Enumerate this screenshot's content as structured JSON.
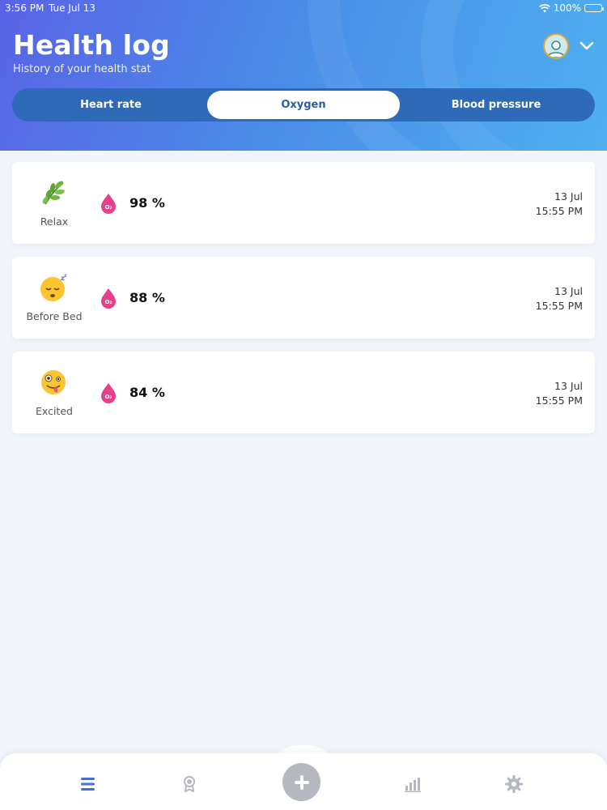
{
  "status_bar": {
    "time": "3:56 PM",
    "date": "Tue Jul 13",
    "battery": "100%",
    "icons": [
      "wifi-icon",
      "battery-icon"
    ]
  },
  "header": {
    "title": "Health log",
    "subtitle": "History of your health stat",
    "avatar_icon": "user-avatar-icon",
    "menu_icon": "chevron-down-icon"
  },
  "tabs": [
    {
      "label": "Heart rate",
      "active": false
    },
    {
      "label": "Oxygen",
      "active": true
    },
    {
      "label": "Blood pressure",
      "active": false
    }
  ],
  "entries": [
    {
      "mood_icon": "herb-icon",
      "mood": "Relax",
      "value": "98 %",
      "date": "13 Jul",
      "time": "15:55 PM"
    },
    {
      "mood_icon": "sleepy-face-icon",
      "mood": "Before Bed",
      "value": "88 %",
      "date": "13 Jul",
      "time": "15:55 PM"
    },
    {
      "mood_icon": "zany-face-icon",
      "mood": "Excited",
      "value": "84 %",
      "date": "13 Jul",
      "time": "15:55 PM"
    }
  ],
  "bottom_nav": [
    {
      "icon": "list-icon",
      "active": true
    },
    {
      "icon": "award-icon",
      "active": false
    },
    {
      "icon": "add-icon",
      "active": false
    },
    {
      "icon": "bar-chart-icon",
      "active": false
    },
    {
      "icon": "gear-icon",
      "active": false
    }
  ],
  "colors": {
    "header_start": "#5a63e6",
    "header_end": "#4fb0ef",
    "tab_bar": "#2e6ab8",
    "tab_active_text": "#2b5ba3",
    "o2_drop": "#e83e8c",
    "nav_active": "#4a6fd0",
    "nav_inactive": "#b5b8bf",
    "background": "#f1f4fb"
  }
}
